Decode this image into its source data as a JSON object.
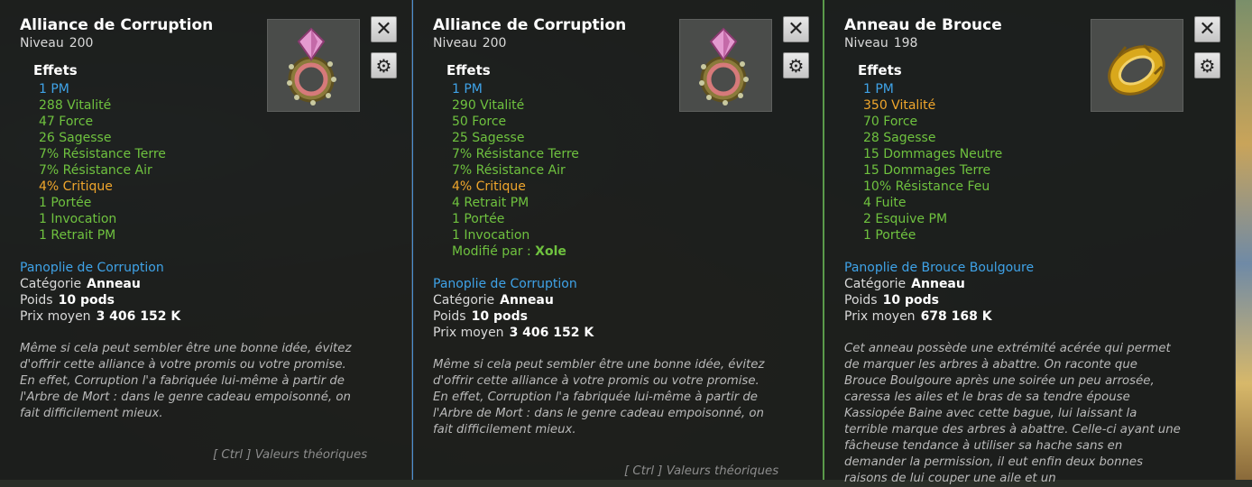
{
  "tooltips": [
    {
      "title": "Alliance de Corruption",
      "level_label": "Niveau",
      "level_value": "200",
      "effets_label": "Effets",
      "effects": [
        {
          "text": "1 PM",
          "color": "blue"
        },
        {
          "text": "288 Vitalité",
          "color": "green"
        },
        {
          "text": "47 Force",
          "color": "green"
        },
        {
          "text": "26 Sagesse",
          "color": "green"
        },
        {
          "text": "7% Résistance Terre",
          "color": "green"
        },
        {
          "text": "7% Résistance Air",
          "color": "green"
        },
        {
          "text": "4% Critique",
          "color": "orange"
        },
        {
          "text": "1 Portée",
          "color": "green"
        },
        {
          "text": "1 Invocation",
          "color": "green"
        },
        {
          "text": "1 Retrait PM",
          "color": "green"
        }
      ],
      "panoplie": "Panoplie de Corruption",
      "categorie_label": "Catégorie",
      "categorie_value": "Anneau",
      "poids_label": "Poids",
      "poids_value": "10 pods",
      "prix_label": "Prix moyen",
      "prix_value": "3 406 152 K",
      "description": "Même si cela peut sembler être une bonne idée, évitez d'offrir cette alliance à votre promis ou votre promise. En effet, Corruption l'a fabriquée lui-même à partir de l'Arbre de Mort : dans le genre cadeau empoisonné, on fait difficilement mieux.",
      "ctrl_hint": "[ Ctrl ] Valeurs théoriques",
      "icon": "corruption-ring-icon"
    },
    {
      "title": "Alliance de Corruption",
      "level_label": "Niveau",
      "level_value": "200",
      "effets_label": "Effets",
      "effects": [
        {
          "text": "1 PM",
          "color": "blue"
        },
        {
          "text": "290 Vitalité",
          "color": "green"
        },
        {
          "text": "50 Force",
          "color": "green"
        },
        {
          "text": "25 Sagesse",
          "color": "green"
        },
        {
          "text": "7% Résistance Terre",
          "color": "green"
        },
        {
          "text": "7% Résistance Air",
          "color": "green"
        },
        {
          "text": "4% Critique",
          "color": "orange"
        },
        {
          "text": "4 Retrait PM",
          "color": "green"
        },
        {
          "text": "1 Portée",
          "color": "green"
        },
        {
          "text": "1 Invocation",
          "color": "green"
        }
      ],
      "modified_label": "Modifié par :",
      "modified_value": "Xole",
      "panoplie": "Panoplie de Corruption",
      "categorie_label": "Catégorie",
      "categorie_value": "Anneau",
      "poids_label": "Poids",
      "poids_value": "10 pods",
      "prix_label": "Prix moyen",
      "prix_value": "3 406 152 K",
      "description": "Même si cela peut sembler être une bonne idée, évitez d'offrir cette alliance à votre promis ou votre promise. En effet, Corruption l'a fabriquée lui-même à partir de l'Arbre de Mort : dans le genre cadeau empoisonné, on fait difficilement mieux.",
      "ctrl_hint": "[ Ctrl ] Valeurs théoriques",
      "icon": "corruption-ring-icon"
    },
    {
      "title": "Anneau de Brouce",
      "level_label": "Niveau",
      "level_value": "198",
      "effets_label": "Effets",
      "effects": [
        {
          "text": "1 PM",
          "color": "blue"
        },
        {
          "text": "350 Vitalité",
          "color": "orange"
        },
        {
          "text": "70 Force",
          "color": "green"
        },
        {
          "text": "28 Sagesse",
          "color": "green"
        },
        {
          "text": "15 Dommages Neutre",
          "color": "green"
        },
        {
          "text": "15 Dommages Terre",
          "color": "green"
        },
        {
          "text": "10% Résistance Feu",
          "color": "green"
        },
        {
          "text": "4 Fuite",
          "color": "green"
        },
        {
          "text": "2 Esquive PM",
          "color": "green"
        },
        {
          "text": "1 Portée",
          "color": "green"
        }
      ],
      "panoplie": "Panoplie de Brouce Boulgoure",
      "categorie_label": "Catégorie",
      "categorie_value": "Anneau",
      "poids_label": "Poids",
      "poids_value": "10 pods",
      "prix_label": "Prix moyen",
      "prix_value": "678 168 K",
      "description": "Cet anneau possède une extrémité acérée qui permet de marquer les arbres à abattre. On raconte que Brouce Boulgoure après une soirée un peu arrosée, caressa les ailes et le bras de sa tendre épouse Kassiopée Baine avec cette bague, lui laissant la terrible marque des arbres à abattre. Celle-ci ayant une fâcheuse tendance à utiliser sa hache sans en demander la permission, il eut enfin deux bonnes raisons de lui couper une aile et un",
      "icon": "brouce-ring-icon"
    }
  ],
  "buttons": {
    "close": "✕",
    "settings": "⚙"
  },
  "colors": {
    "blue": "#3fa3e8",
    "green": "#6fc23f",
    "orange": "#f0a62c"
  }
}
